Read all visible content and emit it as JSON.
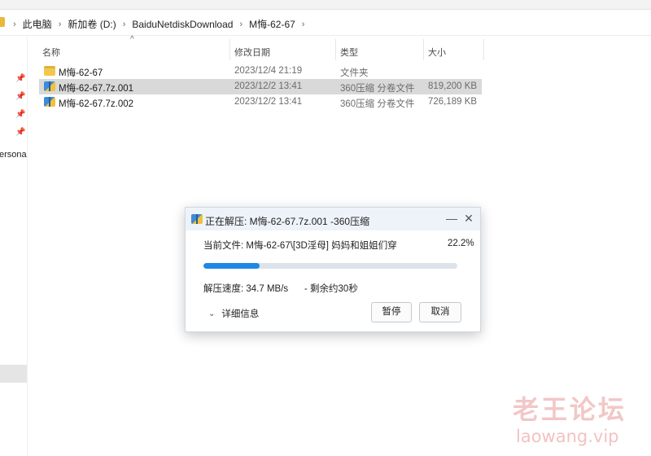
{
  "ribbon": {
    "items": [
      "...",
      "...",
      "...",
      "...",
      "...",
      "..."
    ]
  },
  "breadcrumb": {
    "items": [
      "此电脑",
      "新加卷 (D:)",
      "BaiduNetdiskDownload",
      "M悔-62-67"
    ]
  },
  "nav": {
    "partial_label": "ersona"
  },
  "file_list": {
    "columns": {
      "name": "名称",
      "date": "修改日期",
      "type": "类型",
      "size": "大小"
    },
    "rows": [
      {
        "name": "M悔-62-67",
        "date": "2023/12/4 21:19",
        "type": "文件夹",
        "size": "",
        "icon": "folder-icon"
      },
      {
        "name": "M悔-62-67.7z.001",
        "date": "2023/12/2 13:41",
        "type": "360压缩 分卷文件",
        "size": "819,200 KB",
        "icon": "archive-icon"
      },
      {
        "name": "M悔-62-67.7z.002",
        "date": "2023/12/2 13:41",
        "type": "360压缩 分卷文件",
        "size": "726,189 KB",
        "icon": "archive-icon"
      }
    ]
  },
  "dialog": {
    "title": "正在解压: M悔-62-67.7z.001 -360压缩",
    "current_file": "当前文件: M悔-62-67\\[3D淫母] 妈妈和姐姐们穿",
    "percent_text": "22.2%",
    "progress": 0.222,
    "speed": "解压速度: 34.7 MB/s",
    "remaining": "- 剩余约30秒",
    "details_label": "详细信息",
    "pause_label": "暂停",
    "cancel_label": "取消"
  },
  "watermark": {
    "cn": "老王论坛",
    "en": "laowang.vip"
  },
  "colors": {
    "progress": "#1e88e5",
    "selection": "#d9d9d9",
    "title_bar": "#eef3fa"
  }
}
